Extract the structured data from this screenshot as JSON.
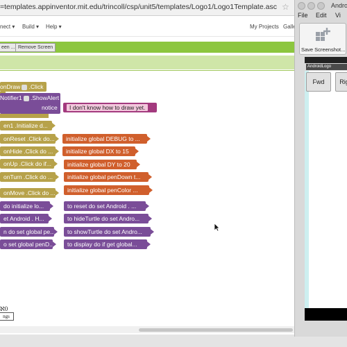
{
  "browser": {
    "url": "=templates.appinventor.mit.edu/trincoll/csp/unit5/templates/Logo1/Logo1Template.asc"
  },
  "menu": {
    "items": [
      "nect ▾",
      "Build ▾",
      "Help ▾"
    ],
    "right_items": [
      "My Projects",
      "Galle"
    ]
  },
  "toolbar": {
    "screen_btn": "een ...",
    "remove_screen_btn": "Remove Screen"
  },
  "blocks": {
    "event_click": "onDraw",
    "click_suffix": ".Click",
    "notifier": "Notifier1",
    "show_alert": ".ShowAlert",
    "notice": "notice",
    "alert_text": "I don't know how to draw yet.",
    "left_column": [
      "en1 .Initialize d...",
      "onReset .Click do...",
      "onHide .Click do ...",
      "onUp .Click do if...",
      "onTurn .Click do ...",
      "onMove .Click do ...",
      "do initialize lo...",
      "et  Android . H...",
      "n do set global pe...",
      "o set global penD..."
    ],
    "right_column": [
      "initialize global DEBUG to ...",
      "initialize global DX to 15",
      "initialize global DY to 20",
      "initialize global penDown t...",
      "initialize global penColor ...",
      "to reset do set  Android . ...",
      "to hideTurtle do set  Andro...",
      "to showTurtle do set  Andro...",
      "to display do if get global..."
    ]
  },
  "footer": {
    "count_label": "ℵ0",
    "box_label": "ngs"
  },
  "emulator": {
    "title": "Andro",
    "menu": [
      "File",
      "Edit",
      "Vi"
    ],
    "save_label": "Save Screenshot...",
    "app_title": "AndroidLogo",
    "buttons": [
      "Fwd",
      "Rig"
    ]
  },
  "colors": {
    "event_block": "#b7a24a",
    "global_block": "#d05f2c",
    "procedure_block": "#7a4d98",
    "string_block": "#a33a7e",
    "toolbar_green": "#8cc63f"
  }
}
